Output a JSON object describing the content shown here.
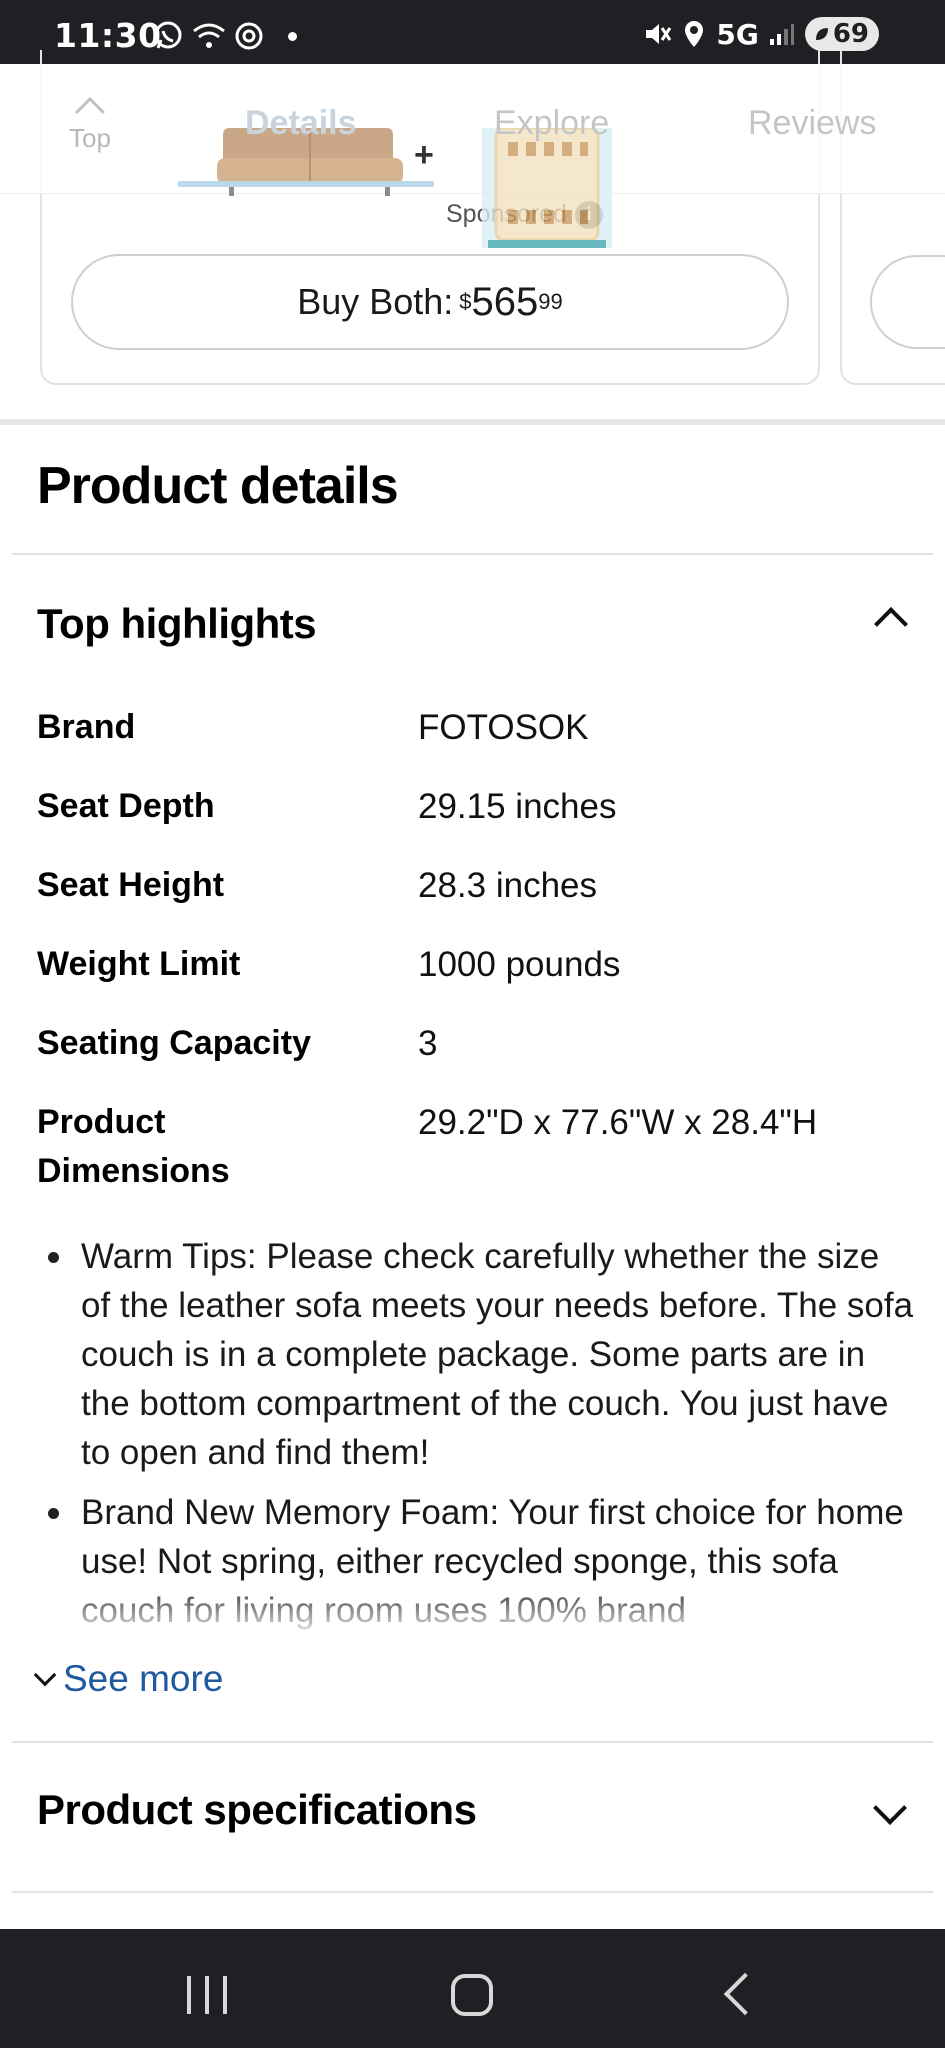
{
  "status_bar": {
    "time": "11:30",
    "network": "5G",
    "battery": "69"
  },
  "nav": {
    "top_label": "Top",
    "tabs": [
      "Details",
      "Explore",
      "Reviews"
    ],
    "bundle_plus": "+"
  },
  "bundle": {
    "sponsored_label": "Sponsored",
    "buy_label": "Buy Both:",
    "price_currency": "$",
    "price_main": "565",
    "price_cents": "99"
  },
  "product_details": {
    "title": "Product details",
    "highlights_title": "Top highlights",
    "specs": [
      {
        "key": "Brand",
        "value": "FOTOSOK"
      },
      {
        "key": "Seat Depth",
        "value": "29.15 inches"
      },
      {
        "key": "Seat Height",
        "value": "28.3 inches"
      },
      {
        "key": "Weight Limit",
        "value": "1000 pounds"
      },
      {
        "key": "Seating Capacity",
        "value": "3"
      },
      {
        "key": "Product Dimensions",
        "value": "29.2\"D x 77.6\"W x 28.4\"H"
      }
    ],
    "bullets": [
      "Warm Tips: Please check carefully whether the size of the leather sofa meets your needs before. The sofa couch is in a complete package. Some parts are in the bottom compartment of the couch. You just have to open and find them!",
      "Brand New Memory Foam: Your first choice for home use! Not spring, either recycled sponge, this sofa couch for living room uses 100% brand"
    ],
    "see_more": "See more",
    "specifications_title": "Product specifications"
  },
  "colors": {
    "link": "#1f5a9e",
    "tab_underline": "#b9d8e8",
    "system_bar": "#1f2024"
  }
}
